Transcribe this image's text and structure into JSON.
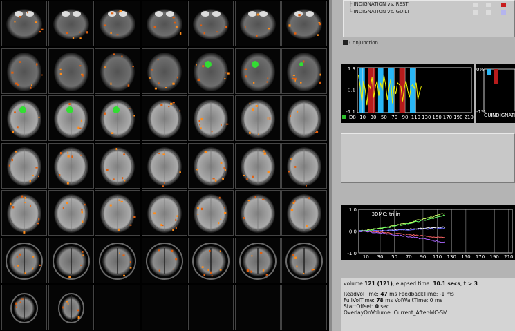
{
  "contrasts": [
    {
      "label": "INDIGNATION vs. REST",
      "swatches": [
        "#dcdcdc",
        "#dcdcdc",
        "#c81e1e"
      ]
    },
    {
      "label": "INDIGNATION vs. GUILT",
      "swatches": [
        "#dcdcdc",
        "#dcdcdc",
        "#b4b4ee"
      ]
    }
  ],
  "conjunction_label": "Conjunction",
  "roi_plot": {
    "legend_label": "D8",
    "legend_color": "#2cc02c",
    "yticks": [
      "1.3",
      "0.1",
      "-1.1"
    ],
    "xticks": [
      "10",
      "30",
      "50",
      "70",
      "90",
      "110",
      "130",
      "150",
      "170",
      "190",
      "210"
    ],
    "xlim": [
      0,
      215
    ],
    "blocks": [
      {
        "start": 4,
        "end": 14,
        "color": "#29b6f6"
      },
      {
        "start": 20,
        "end": 34,
        "color": "#b71c1c"
      },
      {
        "start": 39,
        "end": 49,
        "color": "#29b6f6"
      },
      {
        "start": 58,
        "end": 69,
        "color": "#29b6f6"
      },
      {
        "start": 79,
        "end": 90,
        "color": "#b71c1c"
      },
      {
        "start": 99,
        "end": 110,
        "color": "#29b6f6"
      }
    ],
    "trace": [
      0.9,
      0.3,
      -0.5,
      0.6,
      0.1,
      -0.7,
      0.4,
      0.2,
      0.8,
      -0.3,
      0.3,
      0.6,
      -0.2,
      0.5,
      0.1,
      0.9,
      0.4,
      -0.4,
      0.2,
      0.7,
      -0.6,
      0.3,
      -0.1,
      0.5,
      0.4,
      0.3,
      -0.5,
      0.2,
      0.6,
      0.1,
      -0.3,
      0.3,
      0.4,
      0.2,
      0.5,
      -0.4,
      0.0,
      0.3
    ]
  },
  "beta_plot": {
    "label": "INDIGNATIO",
    "label_prefix": "GUI",
    "yticks": [
      "0%",
      "-1%"
    ],
    "bars": [
      {
        "value": -0.3,
        "color": "#29b6f6"
      },
      {
        "value": -0.8,
        "color": "#b71c1c"
      }
    ]
  },
  "motion_plot": {
    "title": "3DMC: trilin",
    "yticks": [
      "1.0",
      "0.0",
      "-1.0"
    ],
    "xticks": [
      "10",
      "30",
      "50",
      "70",
      "90",
      "110",
      "130",
      "150",
      "170",
      "190",
      "210"
    ],
    "xlim": [
      0,
      215
    ],
    "ylim": [
      -1,
      1
    ],
    "series": [
      {
        "color": "#ccff66",
        "end": 0.82
      },
      {
        "color": "#66ff66",
        "end": 0.72
      },
      {
        "color": "#ffffff",
        "end": 0.18
      },
      {
        "color": "#6666ff",
        "end": 0.14
      },
      {
        "color": "#ff6666",
        "end": -0.32
      },
      {
        "color": "#aa66ff",
        "end": -0.52
      }
    ]
  },
  "status": {
    "volume_line": [
      "volume ",
      "121 (121)",
      ", elapsed time: ",
      "10.1 secs",
      ", ",
      "t > 3"
    ],
    "readvol": [
      "ReadVolTime: ",
      "47",
      " ms FeedbackTime: -1 ms"
    ],
    "fullvol": [
      "FullVolTime: ",
      "78",
      " ms VolWaitTime: 0 ms"
    ],
    "startoffset": [
      "StartOffset: ",
      "0",
      " sec"
    ],
    "overlay": "OverlayOnVolume: Current_After-MC-SM"
  },
  "mosaic": {
    "cols": 7,
    "rows": 7,
    "filled": 44,
    "green_tiles": [
      11,
      12,
      13,
      14,
      15,
      16
    ]
  }
}
